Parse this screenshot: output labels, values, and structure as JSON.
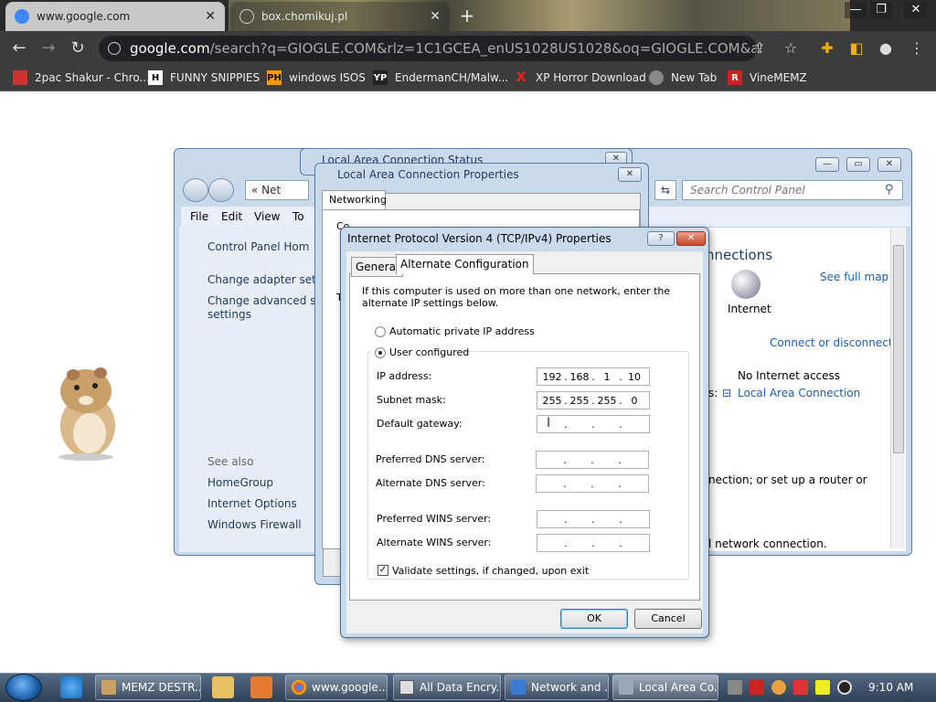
{
  "browser": {
    "tabs": [
      {
        "label": "www.google.com",
        "close": "✕"
      },
      {
        "label": "box.chomikuj.pl",
        "close": "✕"
      }
    ],
    "new_tab": "+",
    "address": {
      "host": "google.com",
      "rest": "/search?q=GIOGLE.COM&rlz=1C1GCEA_enUS1028US1028&oq=GIOGLE.COM&aqs=chrome..69..."
    },
    "bookmarks": [
      {
        "label": "2pac Shakur - Chro...",
        "icon": "bookmark-icon"
      },
      {
        "label": "FUNNY SNIPPIES",
        "icon": "H"
      },
      {
        "label": "windows ISOS",
        "icon": "PH"
      },
      {
        "label": "EndermanCH/Malw...",
        "icon": "YP"
      },
      {
        "label": "XP Horror Download",
        "icon": "X"
      },
      {
        "label": "New Tab",
        "icon": "globe-icon"
      },
      {
        "label": "VineMEMZ",
        "icon": "R"
      }
    ]
  },
  "control_panel": {
    "breadcrumb": "«  Net",
    "search_placeholder": "Search Control Panel",
    "menu": [
      "File",
      "Edit",
      "View",
      "To"
    ],
    "sidebar": {
      "home": "Control Panel Hom",
      "links": [
        "Change adapter set",
        "Change advanced s",
        "settings"
      ],
      "see_also": "See also",
      "see_also_links": [
        "HomeGroup",
        "Internet Options",
        "Windows Firewall"
      ]
    },
    "main": {
      "heading": "nnections",
      "see_full_map": "See full map",
      "internet": "Internet",
      "connect": "Connect or disconnect",
      "no_access": "No Internet access",
      "lac_link": "Local Area Connection",
      "colon": "s:",
      "setup_text": "nection; or set up a router or",
      "network_conn_text": "l network connection."
    }
  },
  "status_dialog": {
    "title": "Local Area Connection Status"
  },
  "properties_dialog": {
    "title": "Local Area Connection Properties",
    "tab": "Networking",
    "partial_c": "Co",
    "partial_t": "T"
  },
  "ipv4_dialog": {
    "title": "Internet Protocol Version 4 (TCP/IPv4) Properties",
    "help": "?",
    "tabs": [
      "General",
      "Alternate Configuration"
    ],
    "description": "If this computer is used on more than one network, enter the alternate IP settings below.",
    "radio_auto": "Automatic private IP address",
    "radio_user": "User configured",
    "fields": [
      {
        "label": "IP address:",
        "octets": [
          "192",
          "168",
          "1",
          "10"
        ]
      },
      {
        "label": "Subnet mask:",
        "octets": [
          "255",
          "255",
          "255",
          "0"
        ]
      },
      {
        "label": "Default gateway:",
        "octets": [
          "",
          "",
          "",
          ""
        ]
      },
      {
        "label": "Preferred DNS server:",
        "octets": [
          "",
          "",
          "",
          ""
        ]
      },
      {
        "label": "Alternate DNS server:",
        "octets": [
          "",
          "",
          "",
          ""
        ]
      },
      {
        "label": "Preferred WINS server:",
        "octets": [
          "",
          "",
          "",
          ""
        ]
      },
      {
        "label": "Alternate WINS server:",
        "octets": [
          "",
          "",
          "",
          ""
        ]
      }
    ],
    "validate": "Validate settings, if changed, upon exit",
    "ok": "OK",
    "cancel": "Cancel"
  },
  "taskbar": {
    "items": [
      "MEMZ DESTR...",
      "www.google....",
      "All Data Encry...",
      "Network and ...",
      "Local Area Co..."
    ],
    "clock": "9:10 AM"
  }
}
